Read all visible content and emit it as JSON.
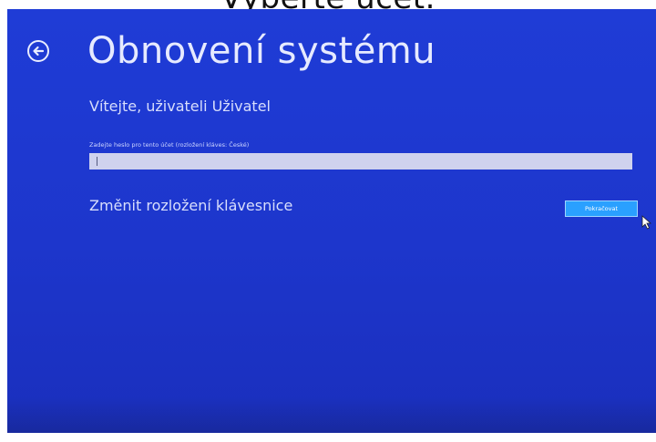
{
  "caption": "Vyberte účet.",
  "screen": {
    "title": "Obnovení systému",
    "welcome": "Vítejte, uživateli Uživatel",
    "password_hint": "Zadejte heslo pro tento účet (rozložení kláves: České)",
    "password_value": "",
    "keyboard_link": "Změnit rozložení klávesnice",
    "restart_button": "Pokračovat"
  },
  "colors": {
    "background": "#1f3cd6",
    "button_accent": "#2aa0ff",
    "field": "#cfd2ee",
    "text": "#e6eaff"
  },
  "icons": {
    "back": "back-arrow-circle-icon",
    "cursor": "mouse-pointer-icon"
  }
}
